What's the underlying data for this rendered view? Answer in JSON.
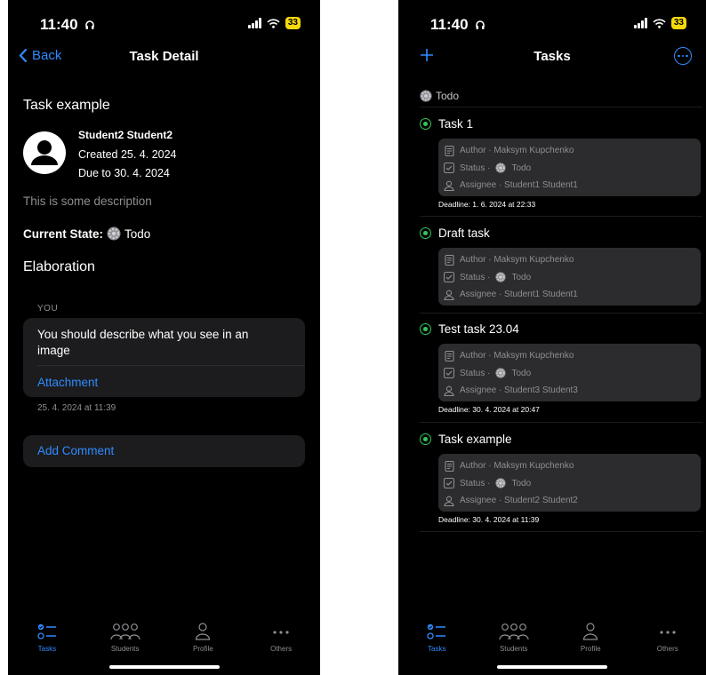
{
  "status": {
    "time": "11:40",
    "battery": "33"
  },
  "left": {
    "nav": {
      "back_label": "Back",
      "title": "Task Detail"
    },
    "task": {
      "title": "Task example",
      "author": "Student2 Student2",
      "created": "Created 25. 4. 2024",
      "due": "Due to 30. 4. 2024",
      "description": "This is some description",
      "state_label": "Current State:",
      "state_value": "Todo"
    },
    "elaboration": {
      "heading": "Elaboration",
      "sender": "YOU",
      "text": "You should describe what you see in an image",
      "attachment": "Attachment",
      "timestamp": "25. 4. 2024 at 11:39",
      "add_comment": "Add Comment"
    }
  },
  "right": {
    "nav": {
      "title": "Tasks"
    },
    "section": "Todo",
    "tasks": [
      {
        "title": "Task 1",
        "author": "Author · Maksym Kupchenko",
        "status_prefix": "Status ·",
        "status": "Todo",
        "assignee": "Assignee · Student1 Student1",
        "deadline": "Deadline: 1. 6. 2024 at 22:33"
      },
      {
        "title": "Draft task",
        "author": "Author · Maksym Kupchenko",
        "status_prefix": "Status ·",
        "status": "Todo",
        "assignee": "Assignee · Student1 Student1",
        "deadline": ""
      },
      {
        "title": "Test task 23.04",
        "author": "Author · Maksym Kupchenko",
        "status_prefix": "Status ·",
        "status": "Todo",
        "assignee": "Assignee · Student3 Student3",
        "deadline": "Deadline: 30. 4. 2024 at 20:47"
      },
      {
        "title": "Task example",
        "author": "Author · Maksym Kupchenko",
        "status_prefix": "Status ·",
        "status": "Todo",
        "assignee": "Assignee · Student2 Student2",
        "deadline": "Deadline: 30. 4. 2024 at 11:39"
      }
    ]
  },
  "tabs": [
    {
      "label": "Tasks",
      "icon": "tasks-icon",
      "active": true
    },
    {
      "label": "Students",
      "icon": "students-icon",
      "active": false
    },
    {
      "label": "Profile",
      "icon": "profile-icon",
      "active": false
    },
    {
      "label": "Others",
      "icon": "more-icon",
      "active": false
    }
  ],
  "colors": {
    "accent": "#2f8bff",
    "done_green": "#34c759",
    "background": "#000000",
    "card": "#1c1c1e"
  }
}
